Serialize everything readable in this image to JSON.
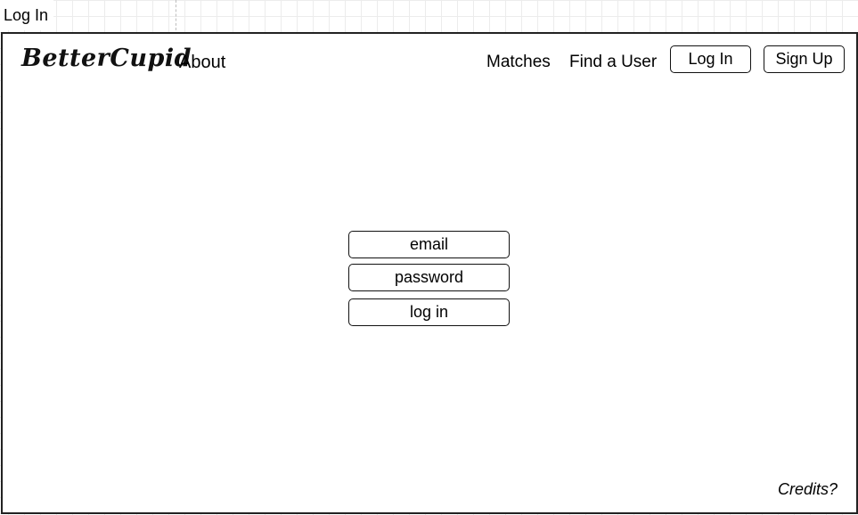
{
  "page": {
    "label": "Log In"
  },
  "header": {
    "logo": "BetterCupid",
    "about": "About",
    "matches": "Matches",
    "find_user": "Find a User",
    "login": "Log In",
    "signup": "Sign Up"
  },
  "login_form": {
    "email": "email",
    "password": "password",
    "submit": "log in"
  },
  "footer": {
    "credits": "Credits?"
  },
  "colors": {
    "stroke": "#111111",
    "background": "#ffffff",
    "grid": "#ececec"
  }
}
